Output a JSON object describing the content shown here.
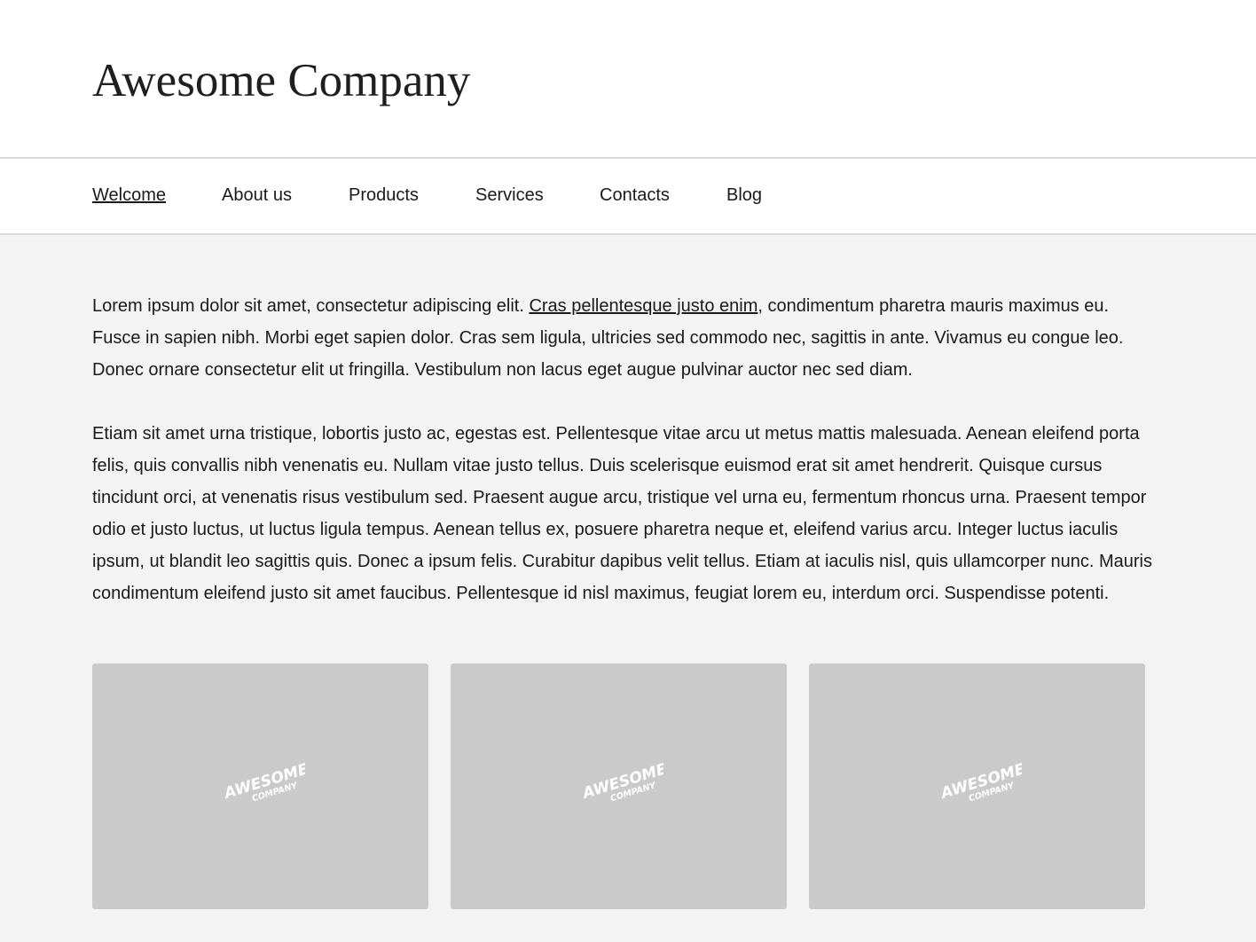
{
  "header": {
    "title": "Awesome Company"
  },
  "nav": {
    "items": [
      {
        "label": "Welcome",
        "active": true
      },
      {
        "label": "About us",
        "active": false
      },
      {
        "label": "Products",
        "active": false
      },
      {
        "label": "Services",
        "active": false
      },
      {
        "label": "Contacts",
        "active": false
      },
      {
        "label": "Blog",
        "active": false
      }
    ]
  },
  "main": {
    "paragraph1": {
      "before_link": "Lorem ipsum dolor sit amet, consectetur adipiscing elit. ",
      "link_text": "Cras pellentesque justo enim",
      "after_link": ", condimentum pharetra mauris maximus eu. Fusce in sapien nibh. Morbi eget sapien dolor. Cras sem ligula, ultricies sed commodo nec, sagittis in ante. Vivamus eu congue leo. Donec ornare consectetur elit ut fringilla. Vestibulum non lacus eget augue pulvinar auctor nec sed diam."
    },
    "paragraph2": "Etiam sit amet urna tristique, lobortis justo ac, egestas est. Pellentesque vitae arcu ut metus mattis malesuada. Aenean eleifend porta felis, quis convallis nibh venenatis eu. Nullam vitae justo tellus. Duis scelerisque euismod erat sit amet hendrerit. Quisque cursus tincidunt orci, at venenatis risus vestibulum sed. Praesent augue arcu, tristique vel urna eu, fermentum rhoncus urna. Praesent tempor odio et justo luctus, ut luctus ligula tempus. Aenean tellus ex, posuere pharetra neque et, eleifend varius arcu. Integer luctus iaculis ipsum, ut blandit leo sagittis quis. Donec a ipsum felis. Curabitur dapibus velit tellus. Etiam at iaculis nisl, quis ullamcorper nunc. Mauris condimentum eleifend justo sit amet faucibus. Pellentesque id nisl maximus, feugiat lorem eu, interdum orci. Suspendisse potenti."
  },
  "gallery": {
    "logo_line1": "AWESOME",
    "logo_line2": "COMPANY",
    "card_count": 3
  },
  "colors": {
    "page_background": "#f3f3f3",
    "header_background": "#ffffff",
    "divider": "#dcdcdc",
    "placeholder_background": "#cacaca",
    "text": "#1a1a1a"
  }
}
